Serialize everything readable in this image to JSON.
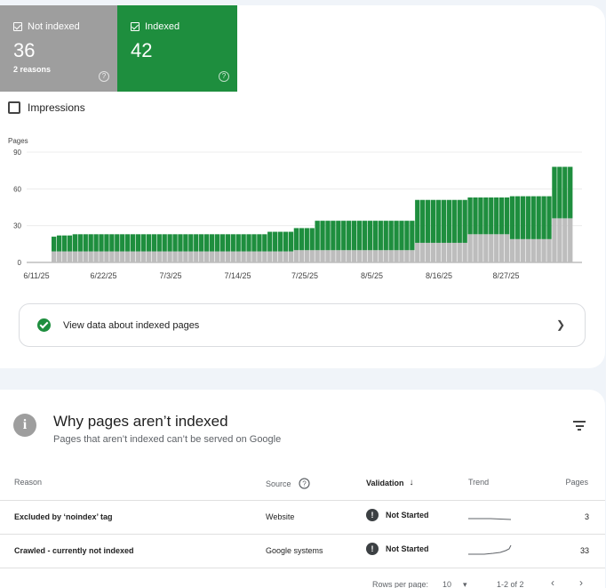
{
  "tiles": {
    "not_indexed": {
      "label": "Not indexed",
      "value": "36",
      "sub": "2 reasons",
      "help": "?"
    },
    "indexed": {
      "label": "Indexed",
      "value": "42",
      "help": "?"
    }
  },
  "impressions_label": "Impressions",
  "chart_data": {
    "type": "bar",
    "stacked": true,
    "ylabel": "Pages",
    "ylim": [
      0,
      90
    ],
    "yticks": [
      "90",
      "60",
      "30",
      "0"
    ],
    "xtick_labels": [
      "6/11/25",
      "6/22/25",
      "7/3/25",
      "7/14/25",
      "7/25/25",
      "8/5/25",
      "8/16/25",
      "8/27/25"
    ],
    "colors": {
      "indexed": "#1e8e3e",
      "not_indexed": "#bdbdbd"
    },
    "series": [
      {
        "name": "Indexed",
        "values": [
          12,
          13,
          13,
          13,
          14,
          14,
          14,
          14,
          14,
          14,
          14,
          14,
          14,
          14,
          14,
          14,
          14,
          14,
          14,
          14,
          14,
          14,
          14,
          14,
          14,
          14,
          14,
          14,
          14,
          14,
          14,
          14,
          14,
          14,
          14,
          14,
          14,
          14,
          14,
          14,
          14,
          16,
          16,
          16,
          16,
          16,
          18,
          18,
          18,
          18,
          24,
          24,
          24,
          24,
          24,
          24,
          24,
          24,
          24,
          24,
          24,
          24,
          24,
          24,
          24,
          24,
          24,
          24,
          24,
          35,
          35,
          35,
          35,
          35,
          35,
          35,
          35,
          35,
          35,
          30,
          30,
          30,
          30,
          30,
          30,
          30,
          30,
          35,
          35,
          35,
          35,
          35,
          35,
          35,
          35,
          42,
          42,
          42,
          42
        ]
      },
      {
        "name": "Not indexed",
        "values": [
          9,
          9,
          9,
          9,
          9,
          9,
          9,
          9,
          9,
          9,
          9,
          9,
          9,
          9,
          9,
          9,
          9,
          9,
          9,
          9,
          9,
          9,
          9,
          9,
          9,
          9,
          9,
          9,
          9,
          9,
          9,
          9,
          9,
          9,
          9,
          9,
          9,
          9,
          9,
          9,
          9,
          9,
          9,
          9,
          9,
          9,
          10,
          10,
          10,
          10,
          10,
          10,
          10,
          10,
          10,
          10,
          10,
          10,
          10,
          10,
          10,
          10,
          10,
          10,
          10,
          10,
          10,
          10,
          10,
          16,
          16,
          16,
          16,
          16,
          16,
          16,
          16,
          16,
          16,
          23,
          23,
          23,
          23,
          23,
          23,
          23,
          23,
          19,
          19,
          19,
          19,
          19,
          19,
          19,
          19,
          36,
          36,
          36,
          36
        ]
      }
    ]
  },
  "view_data_label": "View data about indexed pages",
  "section": {
    "title": "Why pages aren’t indexed",
    "subtitle": "Pages that aren’t indexed can’t be served on Google"
  },
  "table": {
    "headers": {
      "reason": "Reason",
      "source": "Source",
      "validation": "Validation",
      "trend": "Trend",
      "pages": "Pages"
    },
    "rows": [
      {
        "reason": "Excluded by ‘noindex’ tag",
        "source": "Website",
        "validation": "Not Started",
        "pages": "3"
      },
      {
        "reason": "Crawled - currently not indexed",
        "source": "Google systems",
        "validation": "Not Started",
        "pages": "33"
      }
    ]
  },
  "footer": {
    "rows_per_page_label": "Rows per page:",
    "rows_per_page": "10",
    "range": "1-2 of 2"
  }
}
